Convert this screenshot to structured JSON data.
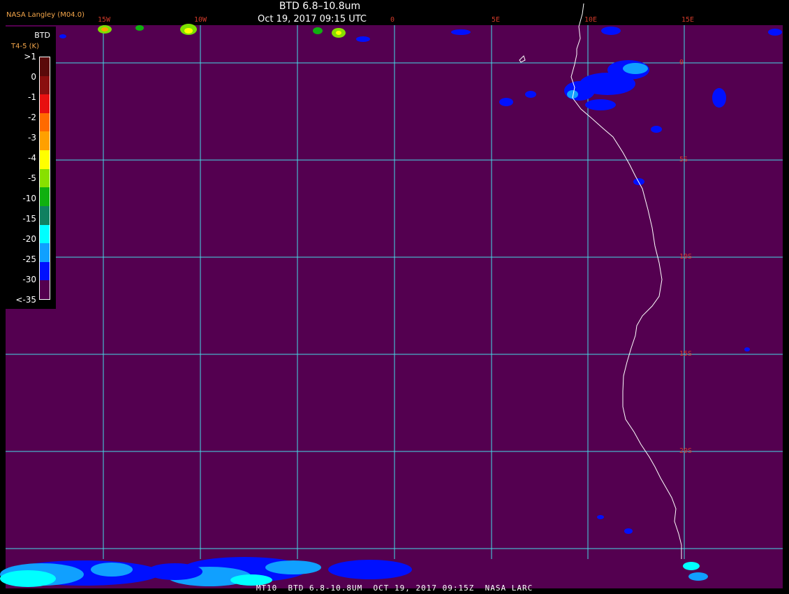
{
  "header": {
    "title": "BTD 6.8–10.8um",
    "subtitle": "Oct 19, 2017 09:15 UTC",
    "producer": "NASA Langley (M04.0)"
  },
  "footer": {
    "text": "MT10  BTD 6.8-10.8UM  OCT 19, 2017 09:15Z  NASA LARC"
  },
  "legend": {
    "title": "BTD",
    "unit": "T4-5 (K)",
    "labels": [
      ">1",
      "0",
      "-1",
      "-2",
      "-3",
      "-4",
      "-5",
      "-10",
      "-15",
      "-20",
      "-25",
      "-30",
      "<-35"
    ],
    "colors": [
      "#5a0a0a",
      "#8a0e0e",
      "#e81010",
      "#ff6a00",
      "#ffa000",
      "#ffff00",
      "#88e000",
      "#10b010",
      "#108060",
      "#00ffff",
      "#10a0ff",
      "#0010ff",
      "#54004f"
    ]
  },
  "map": {
    "background": "#540050",
    "grid_color": "#44dde6",
    "coast_color": "#ffffff",
    "longitude_labels": [
      "15W",
      "10W",
      "0",
      "5E",
      "10E",
      "15E"
    ],
    "latitude_labels": [
      "0",
      "5S",
      "10S",
      "15S",
      "20S"
    ]
  }
}
